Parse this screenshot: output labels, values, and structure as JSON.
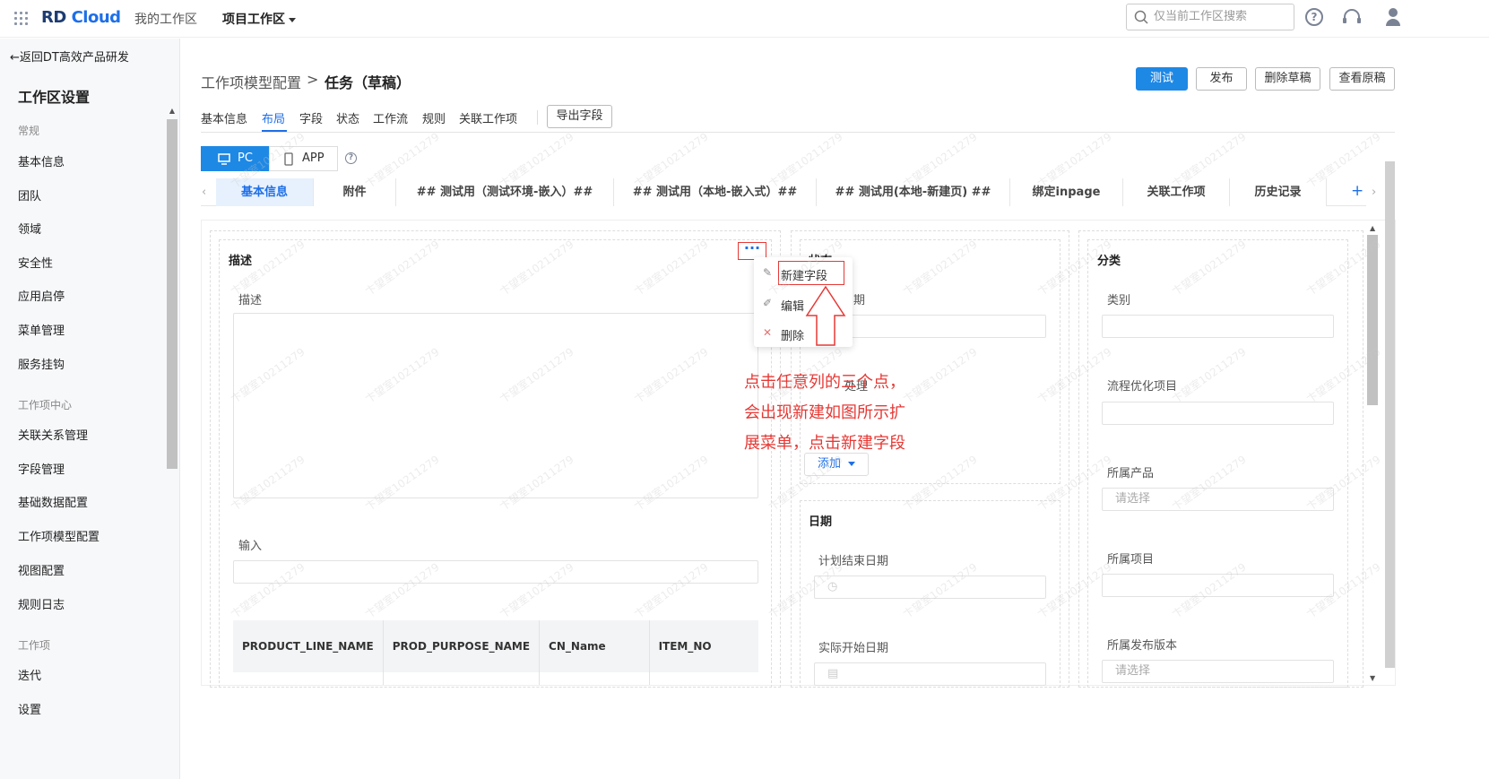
{
  "topbar": {
    "logo_rd": "RD",
    "logo_cloud": "Cloud",
    "nav_my": "我的工作区",
    "nav_project": "项目工作区",
    "search_placeholder": "仅当前工作区搜索"
  },
  "sidebar": {
    "back": "返回DT高效产品研发",
    "title": "工作区设置",
    "groups": [
      {
        "label": "常规",
        "items": [
          "基本信息",
          "团队",
          "领域",
          "安全性",
          "应用启停",
          "菜单管理",
          "服务挂钩"
        ]
      },
      {
        "label": "工作项中心",
        "items": [
          "关联关系管理",
          "字段管理",
          "基础数据配置",
          "工作项模型配置",
          "视图配置",
          "规则日志"
        ]
      },
      {
        "label": "工作项",
        "items": [
          "迭代",
          "设置"
        ]
      }
    ]
  },
  "header": {
    "crumb_parent": "工作项模型配置",
    "crumb_sep": ">",
    "crumb_current": "任务（草稿）",
    "btn_test": "测试",
    "btn_publish": "发布",
    "btn_delete_draft": "删除草稿",
    "btn_view_original": "查看原稿"
  },
  "tabs": [
    "基本信息",
    "布局",
    "字段",
    "状态",
    "工作流",
    "规则",
    "关联工作项"
  ],
  "export_btn": "导出字段",
  "device": {
    "pc": "PC",
    "app": "APP"
  },
  "layout_tabs": [
    "基本信息",
    "附件",
    "## 测试用（测试环境-嵌入）##",
    "## 测试用（本地-嵌入式）##",
    "## 测试用(本地-新建页) ##",
    "绑定inpage",
    "关联工作项",
    "历史记录"
  ],
  "col1": {
    "title": "描述",
    "label_desc": "描述",
    "label_input": "输入",
    "table_headers": [
      "PRODUCT_LINE_NAME",
      "PROD_PURPOSE_NAME",
      "CN_Name",
      "ITEM_NO"
    ]
  },
  "menu": {
    "dots": "···",
    "new_field": "新建字段",
    "edit": "编辑",
    "delete": "删除"
  },
  "col2": {
    "title": "状态",
    "label_date_partial": "期",
    "label_hidden": "处理",
    "add_btn": "添加",
    "date_title": "日期",
    "plan_end": "计划结束日期",
    "actual_start": "实际开始日期"
  },
  "col3": {
    "title": "分类",
    "category": "类别",
    "flow_project": "流程优化项目",
    "product": "所属产品",
    "product_placeholder": "请选择",
    "project": "所属项目",
    "release": "所属发布版本",
    "release_placeholder": "请选择"
  },
  "annotation": [
    "点击任意列的三个点，",
    "会出现新建如图所示扩",
    "展菜单，点击新建字段"
  ],
  "watermark": "卞望室10211279"
}
